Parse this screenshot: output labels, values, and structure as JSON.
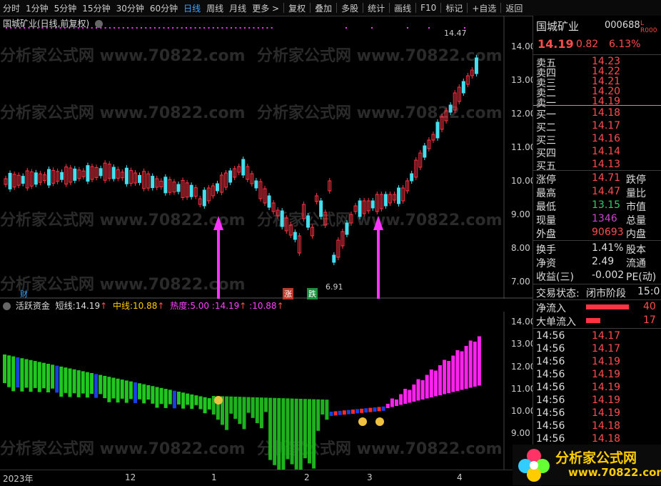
{
  "toolbar": {
    "items": [
      "分时",
      "1分钟",
      "5分钟",
      "15分钟",
      "30分钟",
      "60分钟",
      "日线",
      "周线",
      "月线",
      "更多 >"
    ],
    "right_items": [
      "复权",
      "叠加",
      "多股",
      "统计",
      "画线",
      "F10",
      "标记",
      "+自选",
      "返回"
    ],
    "active": "日线"
  },
  "main_chart": {
    "title": "国城矿业(日线,前复权)",
    "high_label": "14.47",
    "low_label": "6.91",
    "badge_cai": "财",
    "badge_zhang": "涨",
    "badge_die": "跌",
    "y_ticks": [
      "14.00",
      "13.00",
      "12.00",
      "11.00",
      "10.00",
      "9.00",
      "8.00",
      "7.00"
    ]
  },
  "indicator": {
    "name": "活跃资金",
    "short_label": "短线:",
    "short_value": "14.19",
    "mid_label": "中线:",
    "mid_value": "10.88",
    "heat_label": "热度:",
    "heat_value": "5.00",
    "extra1": ":14.19",
    "extra2": ":10.88",
    "y_ticks": [
      "14.00",
      "13.00",
      "12.00",
      "11.00",
      "10.00",
      "9.00"
    ]
  },
  "x_axis": [
    "2023年",
    "12",
    "1",
    "2",
    "3",
    "4"
  ],
  "quote": {
    "name": "国城矿业",
    "code": "000688",
    "tag": "L R000",
    "price": "14.19",
    "change": "0.82",
    "pct": "6.13%",
    "asks": [
      {
        "label": "卖五",
        "price": "14.23"
      },
      {
        "label": "卖四",
        "price": "14.22"
      },
      {
        "label": "卖三",
        "price": "14.21"
      },
      {
        "label": "卖二",
        "price": "14.20"
      },
      {
        "label": "卖一",
        "price": "14.19"
      }
    ],
    "bids": [
      {
        "label": "买一",
        "price": "14.18"
      },
      {
        "label": "买二",
        "price": "14.17"
      },
      {
        "label": "买三",
        "price": "14.16"
      },
      {
        "label": "买四",
        "price": "14.14"
      },
      {
        "label": "买五",
        "price": "14.13"
      }
    ],
    "stats": [
      {
        "l": "涨停",
        "v": "14.71",
        "r": "跌停",
        "c": "#ff4d4d"
      },
      {
        "l": "最高",
        "v": "14.47",
        "r": "量比",
        "c": "#ff4d4d"
      },
      {
        "l": "最低",
        "v": "13.15",
        "r": "市值",
        "c": "#33cc66"
      },
      {
        "l": "现量",
        "v": "1346",
        "r": "总量",
        "c": "#cc44cc"
      },
      {
        "l": "外盘",
        "v": "90693",
        "r": "内盘",
        "c": "#ff4d4d"
      }
    ],
    "stats2": [
      {
        "l": "换手",
        "v": "1.41%",
        "r": "股本"
      },
      {
        "l": "净资",
        "v": "2.49",
        "r": "流通"
      },
      {
        "l": "收益(三)",
        "v": "-0.002",
        "r": "PE(动)"
      }
    ],
    "status_label": "交易状态:",
    "status_value": "闭市阶段",
    "status_time": "15:0",
    "net_in": "净流入",
    "net_in_val": "40",
    "big_in": "大单流入",
    "big_in_val": "17",
    "ticks": [
      {
        "t": "14:56",
        "p": "14.17"
      },
      {
        "t": "14:56",
        "p": "14.17"
      },
      {
        "t": "14:56",
        "p": "14.19"
      },
      {
        "t": "14:56",
        "p": "14.19"
      },
      {
        "t": "14:56",
        "p": "14.19"
      },
      {
        "t": "14:56",
        "p": "14.19"
      },
      {
        "t": "14:56",
        "p": "14.19"
      },
      {
        "t": "14:56",
        "p": "14.18"
      },
      {
        "t": "14:56",
        "p": "14.18"
      }
    ]
  },
  "watermark": "分析家公式网 www.70822.com",
  "logo": {
    "title": "分析家公式网",
    "url": "www.70822.com"
  }
}
